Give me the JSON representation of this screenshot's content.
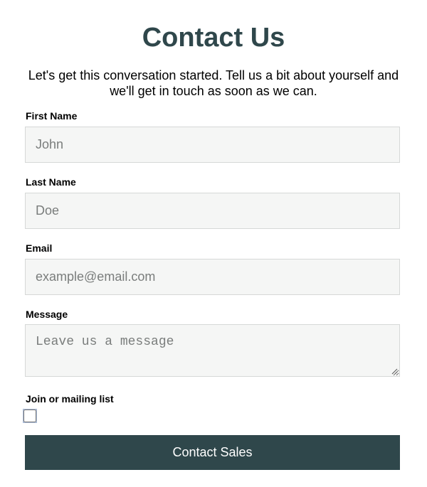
{
  "form": {
    "title": "Contact Us",
    "subtitle": "Let's get this conversation started. Tell us a bit about yourself and we'll get in touch as soon as we can.",
    "first_name": {
      "label": "First Name",
      "placeholder": "John",
      "value": ""
    },
    "last_name": {
      "label": "Last Name",
      "placeholder": "Doe",
      "value": ""
    },
    "email": {
      "label": "Email",
      "placeholder": "example@email.com",
      "value": ""
    },
    "message": {
      "label": "Message",
      "placeholder": "Leave us a message",
      "value": ""
    },
    "mailing_list": {
      "label": "Join or mailing list",
      "checked": false
    },
    "submit_label": "Contact Sales"
  },
  "colors": {
    "accent": "#2f474b",
    "field_background": "#f5f6f5",
    "field_border": "#d6d8d7",
    "checkbox_border": "#3d5a8c"
  },
  "icons": {
    "textarea_resize": "resize-handle-icon"
  }
}
